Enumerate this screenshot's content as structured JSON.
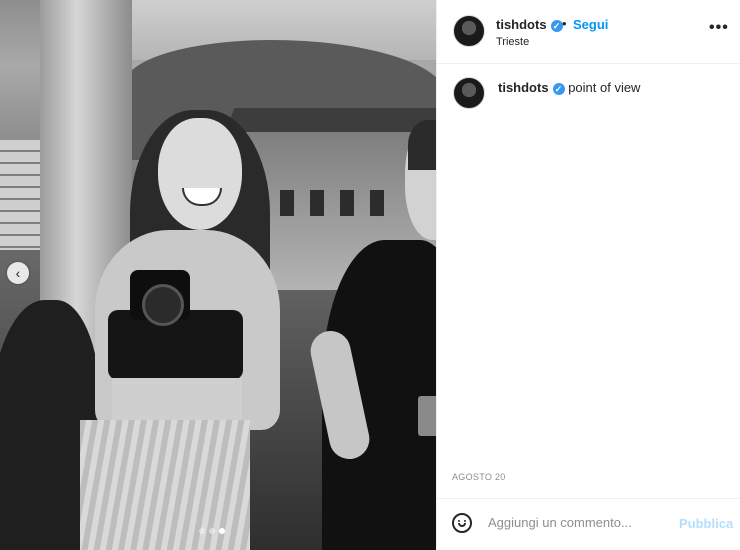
{
  "post": {
    "author": "tishdots",
    "separator": "•",
    "follow_label": "Segui",
    "location": "Trieste",
    "more_label": "•••",
    "caption": {
      "username": "tishdots",
      "text": "point of view"
    },
    "date": "AGOSTO 20",
    "comment": {
      "placeholder": "Aggiungi un commento...",
      "publish_label": "Pubblica"
    }
  },
  "carousel": {
    "prev_label": "‹",
    "slide_count": 3,
    "active_index": 2
  },
  "icons": {
    "verified": "verified-badge-icon",
    "emoji": "emoji-icon",
    "more": "more-options-icon",
    "prev": "chevron-left-icon"
  },
  "colors": {
    "accent": "#0095f6",
    "verified": "#3897f0",
    "publish_disabled": "#b2dffc",
    "muted_text": "#8e8e8e"
  }
}
